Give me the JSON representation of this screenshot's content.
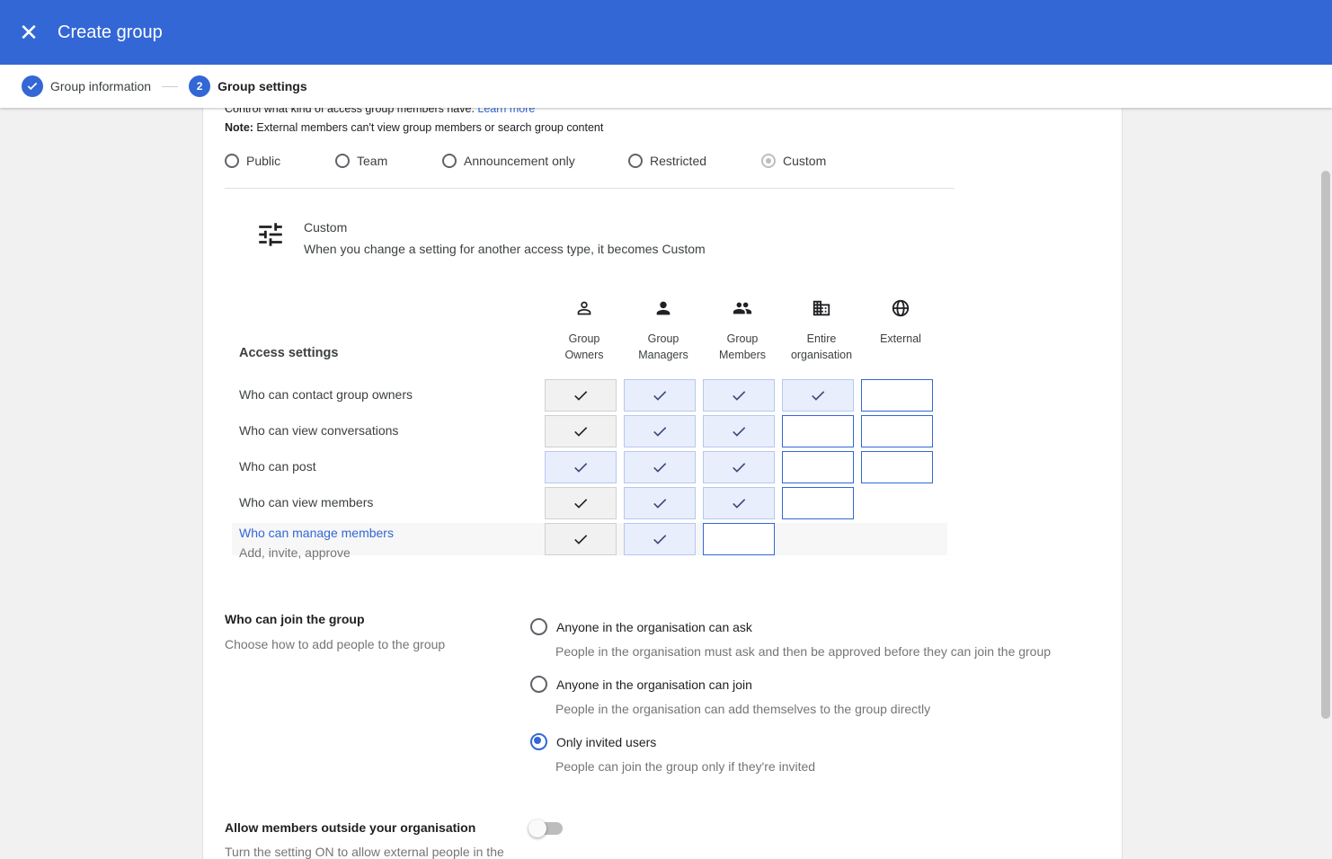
{
  "header": {
    "close_icon": "close-icon",
    "title": "Create group"
  },
  "stepper": {
    "step1": {
      "label": "Group information",
      "state": "completed"
    },
    "step2": {
      "number": "2",
      "label": "Group settings",
      "state": "active"
    }
  },
  "access": {
    "intro_text": "Control what kind of access group members have.",
    "learn_more": "Learn more",
    "note_bold": "Note:",
    "note_text": " External members can't view group members or search group content",
    "options": [
      {
        "label": "Public",
        "selected": false
      },
      {
        "label": "Team",
        "selected": false
      },
      {
        "label": "Announcement only",
        "selected": false
      },
      {
        "label": "Restricted",
        "selected": false
      },
      {
        "label": "Custom",
        "selected": true
      }
    ],
    "custom_title": "Custom",
    "custom_desc": "When you change a setting for another access type, it becomes Custom"
  },
  "access_table": {
    "header_label": "Access settings",
    "columns": [
      {
        "line1": "Group",
        "line2": "Owners",
        "icon": "person-outline-icon"
      },
      {
        "line1": "Group",
        "line2": "Managers",
        "icon": "person-icon"
      },
      {
        "line1": "Group",
        "line2": "Members",
        "icon": "people-icon"
      },
      {
        "line1": "Entire",
        "line2": "organisation",
        "icon": "building-icon"
      },
      {
        "line1": "External",
        "line2": "",
        "icon": "globe-icon"
      }
    ],
    "rows": [
      {
        "label": "Who can contact group owners",
        "sub": ""
      },
      {
        "label": "Who can view conversations",
        "sub": ""
      },
      {
        "label": "Who can post",
        "sub": ""
      },
      {
        "label": "Who can view members",
        "sub": ""
      },
      {
        "label": "Who can manage members",
        "sub": "Add, invite, approve"
      }
    ]
  },
  "join": {
    "title": "Who can join the group",
    "subtitle": "Choose how to add people to the group",
    "options": [
      {
        "label": "Anyone in the organisation can ask",
        "desc": "People in the organisation must ask and then be approved before they can join the group",
        "selected": false
      },
      {
        "label": "Anyone in the organisation can join",
        "desc": "People in the organisation can add themselves to the group directly",
        "selected": false
      },
      {
        "label": "Only invited users",
        "desc": "People can join the group only if they're invited",
        "selected": true
      }
    ]
  },
  "external": {
    "title": "Allow members outside your organisation",
    "desc": "Turn the setting ON to allow external people in the",
    "toggle_on": false
  },
  "colors": {
    "primary": "#3367d6",
    "cell_blue": "#e8eefb",
    "cell_grey": "#f1f1f1"
  }
}
